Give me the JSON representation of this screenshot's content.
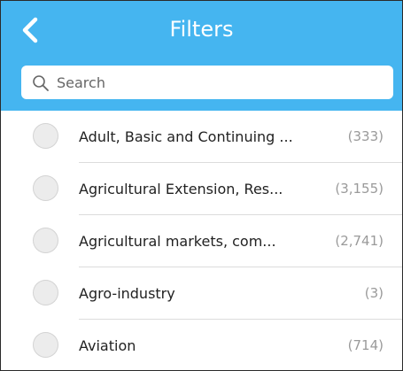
{
  "header": {
    "title": "Filters",
    "back_icon": "chevron-left-icon",
    "background_color": "#45b5f0"
  },
  "search": {
    "placeholder": "Search",
    "value": "",
    "icon": "search-icon"
  },
  "filters": [
    {
      "label": "Adult, Basic and Continuing ...",
      "count": "(333)",
      "selected": false
    },
    {
      "label": "Agricultural Extension, Res...",
      "count": "(3,155)",
      "selected": false
    },
    {
      "label": "Agricultural markets, com...",
      "count": "(2,741)",
      "selected": false
    },
    {
      "label": "Agro-industry",
      "count": "(3)",
      "selected": false
    },
    {
      "label": "Aviation",
      "count": "(714)",
      "selected": false
    }
  ]
}
